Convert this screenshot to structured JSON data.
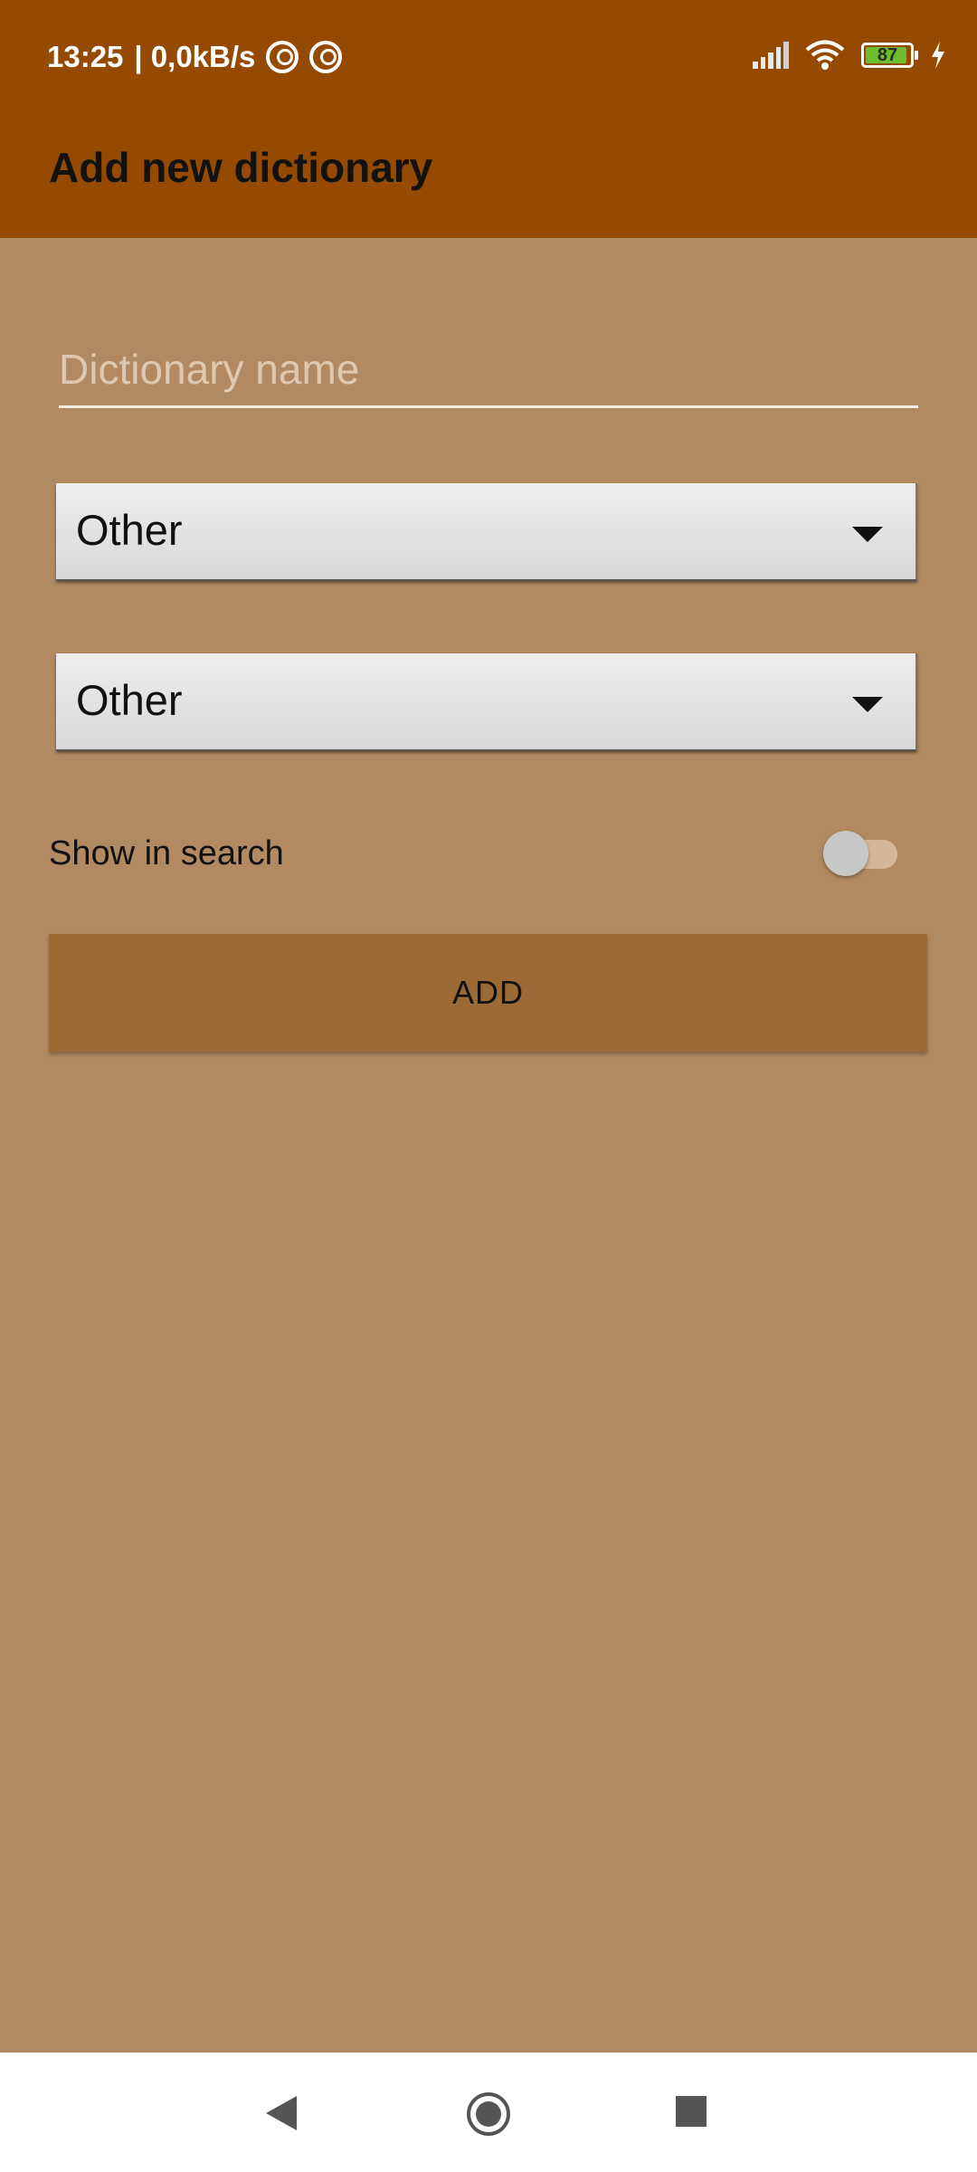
{
  "status_bar": {
    "time": "13:25",
    "network_speed": "| 0,0kB/s",
    "battery_level": "87",
    "icons": [
      "vpn-circle-icon",
      "vpn-circle-icon",
      "signal-icon",
      "wifi-icon",
      "battery-icon",
      "charging-bolt-icon"
    ]
  },
  "app_bar": {
    "title": "Add new dictionary"
  },
  "form": {
    "name_placeholder": "Dictionary name",
    "name_value": "",
    "spinner_1_value": "Other",
    "spinner_2_value": "Other",
    "toggle_label": "Show in search",
    "toggle_on": false,
    "add_label": "ADD"
  },
  "nav_bar": {
    "icons": [
      "back-icon",
      "home-icon",
      "recents-icon"
    ]
  },
  "colors": {
    "app_bar": "#954a00",
    "background": "#b28a61",
    "button": "#9d6a36"
  }
}
